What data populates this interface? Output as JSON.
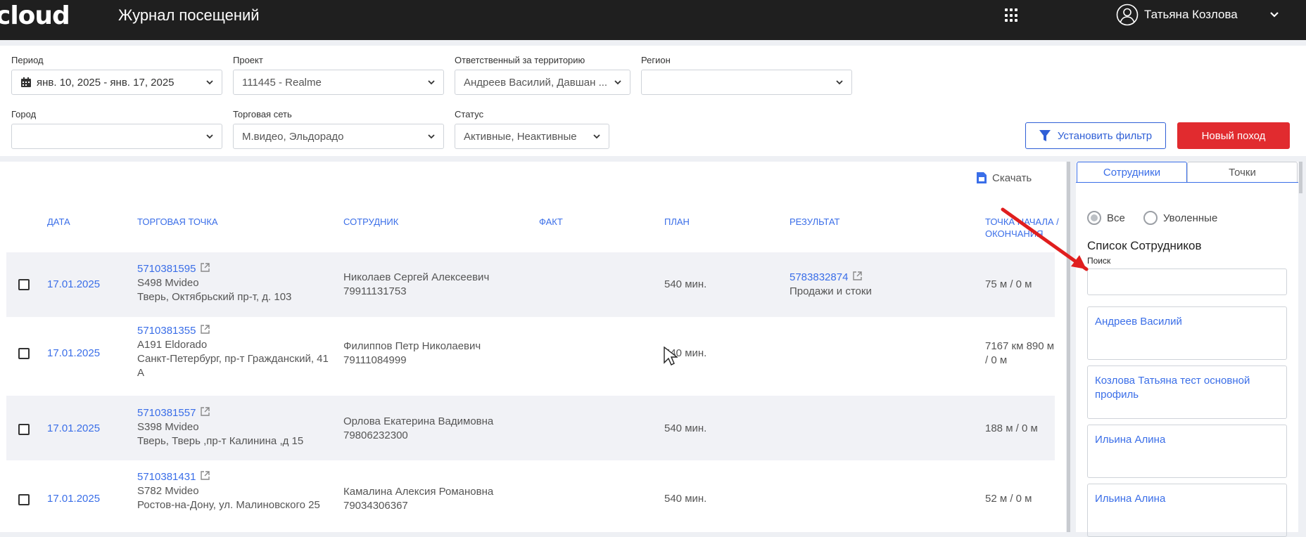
{
  "header": {
    "logo": "cloud",
    "title": "Журнал посещений",
    "user_name": "Татьяна Козлова"
  },
  "filters": {
    "period": {
      "label": "Период",
      "value": "янв. 10, 2025 - янв. 17, 2025"
    },
    "project": {
      "label": "Проект",
      "value": "111445 - Realme"
    },
    "responsible": {
      "label": "Ответственный за территорию",
      "value": "Андреев Василий, Давшан ..."
    },
    "region": {
      "label": "Регион",
      "value": ""
    },
    "city": {
      "label": "Город",
      "value": ""
    },
    "chain": {
      "label": "Торговая сеть",
      "value": "М.видео, Эльдорадо"
    },
    "status": {
      "label": "Статус",
      "value": "Активные, Неактивные"
    },
    "apply_button": "Установить фильтр",
    "new_button": "Новый поход"
  },
  "table": {
    "download_label": "Скачать",
    "headers": [
      "ДАТА",
      "ТОРГОВАЯ ТОЧКА",
      "СОТРУДНИК",
      "ФАКТ",
      "ПЛАН",
      "РЕЗУЛЬТАТ",
      "ТОЧКА НАЧАЛА / ОКОНЧАНИЯ"
    ],
    "rows": [
      {
        "date": "17.01.2025",
        "point_id": "5710381595",
        "point_name": "S498 Mvideo",
        "address": "Тверь, Октябрьский пр-т, д. 103",
        "employee": "Николаев Сергей Алексеевич",
        "phone": "79911131753",
        "fact": "",
        "plan": "540 мин.",
        "result_id": "5783832874",
        "result_text": "Продажи и стоки",
        "distance": "75 м / 0 м"
      },
      {
        "date": "17.01.2025",
        "point_id": "5710381355",
        "point_name": "A191 Eldorado",
        "address": "Санкт-Петербург, пр-т Гражданский, 41 А",
        "employee": "Филиппов Петр Николаевич",
        "phone": "79111084999",
        "fact": "",
        "plan": "540 мин.",
        "result_id": "",
        "result_text": "",
        "distance": "7167 км 890 м / 0 м"
      },
      {
        "date": "17.01.2025",
        "point_id": "5710381557",
        "point_name": "S398 Mvideo",
        "address": "Тверь, Тверь ,пр-т Калинина ,д 15",
        "employee": "Орлова Екатерина Вадимовна",
        "phone": "79806232300",
        "fact": "",
        "plan": "540 мин.",
        "result_id": "",
        "result_text": "",
        "distance": "188 м / 0 м"
      },
      {
        "date": "17.01.2025",
        "point_id": "5710381431",
        "point_name": "S782 Mvideo",
        "address": "Ростов-на-Дону, ул. Малиновского 25",
        "employee": "Камалина Алексия Романовна",
        "phone": "79034306367",
        "fact": "",
        "plan": "540 мин.",
        "result_id": "",
        "result_text": "",
        "distance": "52 м / 0 м"
      }
    ]
  },
  "side": {
    "tabs": [
      "Сотрудники",
      "Точки"
    ],
    "radio_all": "Все",
    "radio_fired": "Уволенные",
    "list_title": "Список Сотрудников",
    "search_label": "Поиск",
    "search_value": "",
    "employees": [
      "Андреев Василий",
      "Козлова Татьяна тест основной профиль",
      "Ильина Алина",
      "Ильина Алина"
    ]
  }
}
